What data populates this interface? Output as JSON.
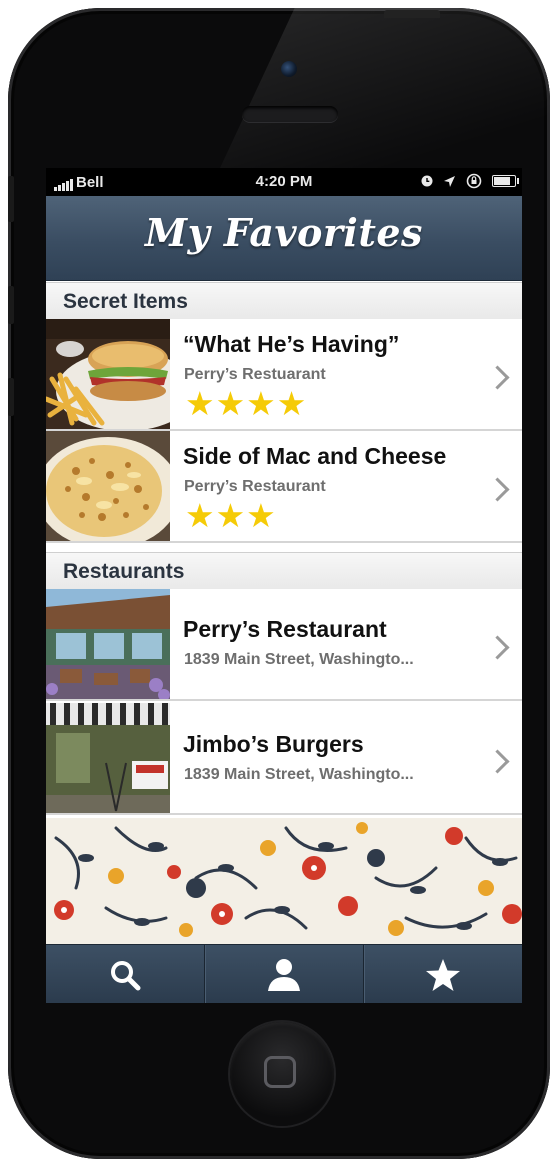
{
  "status_bar": {
    "carrier": "Bell",
    "time": "4:20 PM"
  },
  "header": {
    "title": "My Favorites"
  },
  "sections": [
    {
      "title": "Secret Items",
      "items": [
        {
          "title": "“What He’s Having”",
          "subtitle": "Perry’s Restuarant",
          "rating": 4,
          "stars": "★★★★",
          "thumbnail": "burger-and-fries"
        },
        {
          "title": "Side of Mac and Cheese",
          "subtitle": "Perry’s Restaurant",
          "rating": 3,
          "stars": "★★★",
          "thumbnail": "mac-and-cheese"
        }
      ]
    },
    {
      "title": "Restaurants",
      "items": [
        {
          "title": "Perry’s Restaurant",
          "subtitle": "1839 Main Street, Washingto...",
          "thumbnail": "restaurant-patio"
        },
        {
          "title": "Jimbo’s Burgers",
          "subtitle": "1839 Main Street, Washingto...",
          "thumbnail": "burger-storefront"
        }
      ]
    }
  ],
  "tab_bar": {
    "tabs": [
      {
        "icon": "search-icon"
      },
      {
        "icon": "user-icon"
      },
      {
        "icon": "star-icon"
      }
    ]
  },
  "colors": {
    "nav_bar": "#3a4d62",
    "star": "#f5cb07",
    "section_text": "#2b3440"
  }
}
